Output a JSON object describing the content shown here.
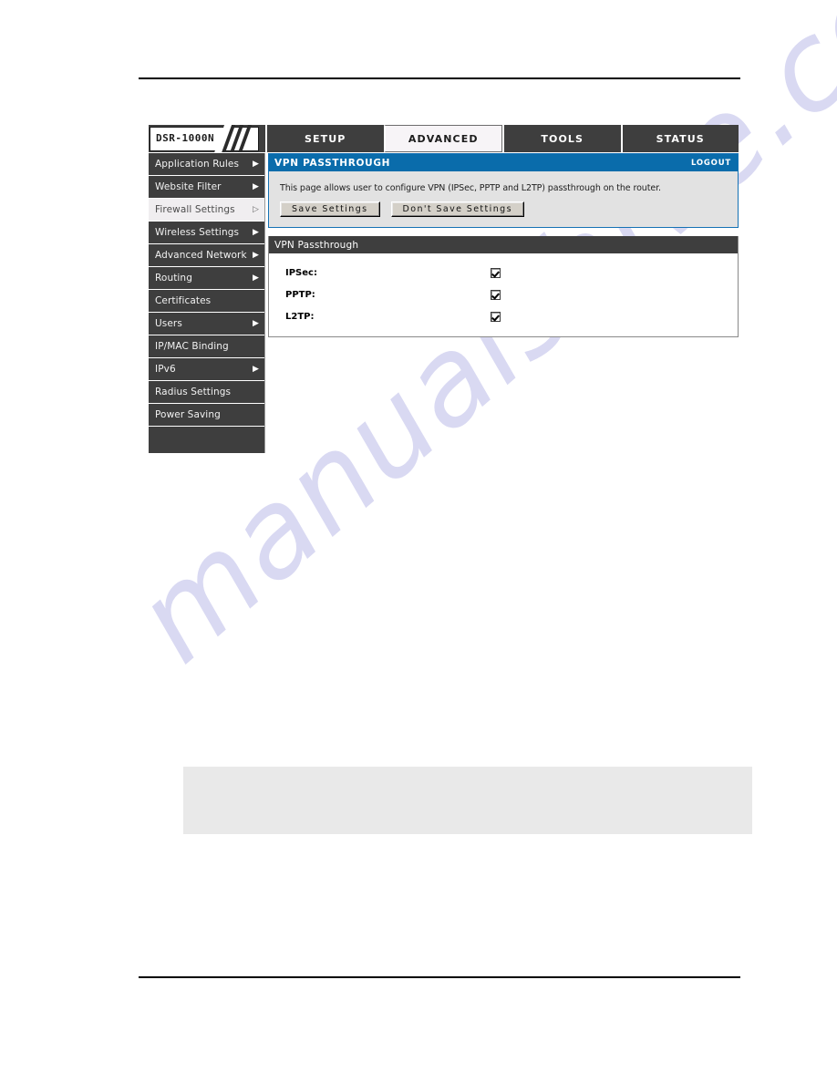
{
  "topnav": {
    "logo": "DSR-1000N",
    "tabs": [
      {
        "label": "SETUP",
        "active": false
      },
      {
        "label": "ADVANCED",
        "active": true
      },
      {
        "label": "TOOLS",
        "active": false
      },
      {
        "label": "STATUS",
        "active": false
      }
    ]
  },
  "sidebar": {
    "items": [
      {
        "label": "Application Rules",
        "arrow": "filled",
        "selected": false
      },
      {
        "label": "Website Filter",
        "arrow": "filled",
        "selected": false
      },
      {
        "label": "Firewall Settings",
        "arrow": "hollow",
        "selected": true
      },
      {
        "label": "Wireless Settings",
        "arrow": "filled",
        "selected": false
      },
      {
        "label": "Advanced Network",
        "arrow": "filled",
        "selected": false
      },
      {
        "label": "Routing",
        "arrow": "filled",
        "selected": false
      },
      {
        "label": "Certificates",
        "arrow": "none",
        "selected": false
      },
      {
        "label": "Users",
        "arrow": "filled",
        "selected": false
      },
      {
        "label": "IP/MAC Binding",
        "arrow": "none",
        "selected": false
      },
      {
        "label": "IPv6",
        "arrow": "filled",
        "selected": false
      },
      {
        "label": "Radius Settings",
        "arrow": "none",
        "selected": false
      },
      {
        "label": "Power Saving",
        "arrow": "none",
        "selected": false
      }
    ]
  },
  "help": {
    "title": "VPN PASSTHROUGH",
    "logout": "LOGOUT",
    "description": "This page allows user to configure VPN (IPSec, PPTP and L2TP) passthrough on the router.",
    "save_label": "Save Settings",
    "dont_save_label": "Don't Save Settings"
  },
  "settings": {
    "section_title": "VPN Passthrough",
    "rows": [
      {
        "label": "IPSec:",
        "checked": true
      },
      {
        "label": "PPTP:",
        "checked": true
      },
      {
        "label": "L2TP:",
        "checked": true
      }
    ]
  },
  "watermark": {
    "text": "manualshive.com"
  },
  "colors": {
    "accent_blue": "#0a6cab",
    "dark_chrome": "#3e3e3e",
    "panel_gray": "#e2e2e2",
    "button_face": "#d4d0c8",
    "watermark": "#d9d9f2"
  }
}
